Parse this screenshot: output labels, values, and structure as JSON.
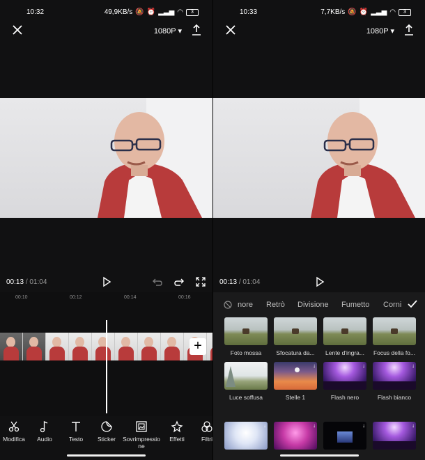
{
  "left": {
    "status": {
      "time": "10:32",
      "net": "49,9KB/s",
      "battery": "3"
    },
    "resolution": "1080P",
    "time_current": "00:13",
    "time_total": "/ 01:04",
    "ruler": [
      "00:10",
      "00:12",
      "00:14",
      "00:16"
    ],
    "tools": [
      {
        "label": "Modifica",
        "icon": "scissors-icon"
      },
      {
        "label": "Audio",
        "icon": "music-note-icon"
      },
      {
        "label": "Testo",
        "icon": "text-icon"
      },
      {
        "label": "Sticker",
        "icon": "sticker-icon"
      },
      {
        "label": "Sovrimpressio",
        "label2": "ne",
        "icon": "overlay-icon"
      },
      {
        "label": "Effetti",
        "icon": "effects-star-icon"
      },
      {
        "label": "Filtri",
        "icon": "filters-icon"
      }
    ]
  },
  "right": {
    "status": {
      "time": "10:33",
      "net": "7,7KB/s",
      "battery": "3"
    },
    "resolution": "1080P",
    "time_current": "00:13",
    "time_total": "/ 01:04",
    "categories": [
      "nore",
      "Retrò",
      "Divisione",
      "Fumetto",
      "Corni"
    ],
    "effects": [
      {
        "label": "Foto mossa",
        "style": "field"
      },
      {
        "label": "Sfocatura da...",
        "style": "field"
      },
      {
        "label": "Lente d'ingra...",
        "style": "field"
      },
      {
        "label": "Focus della fo...",
        "style": "field"
      },
      {
        "label": "Luce soffusa",
        "style": "mist"
      },
      {
        "label": "Stelle 1",
        "style": "sunset"
      },
      {
        "label": "Flash nero",
        "style": "concert"
      },
      {
        "label": "Flash bianco",
        "style": "concert"
      },
      {
        "label": "",
        "style": "bright"
      },
      {
        "label": "",
        "style": "pink"
      },
      {
        "label": "",
        "style": "dark"
      },
      {
        "label": "",
        "style": "concert"
      }
    ]
  },
  "colors": {
    "accent_red": "#b83b3b",
    "panel_bg": "#111112",
    "effects_bg": "#1a1a1b"
  }
}
